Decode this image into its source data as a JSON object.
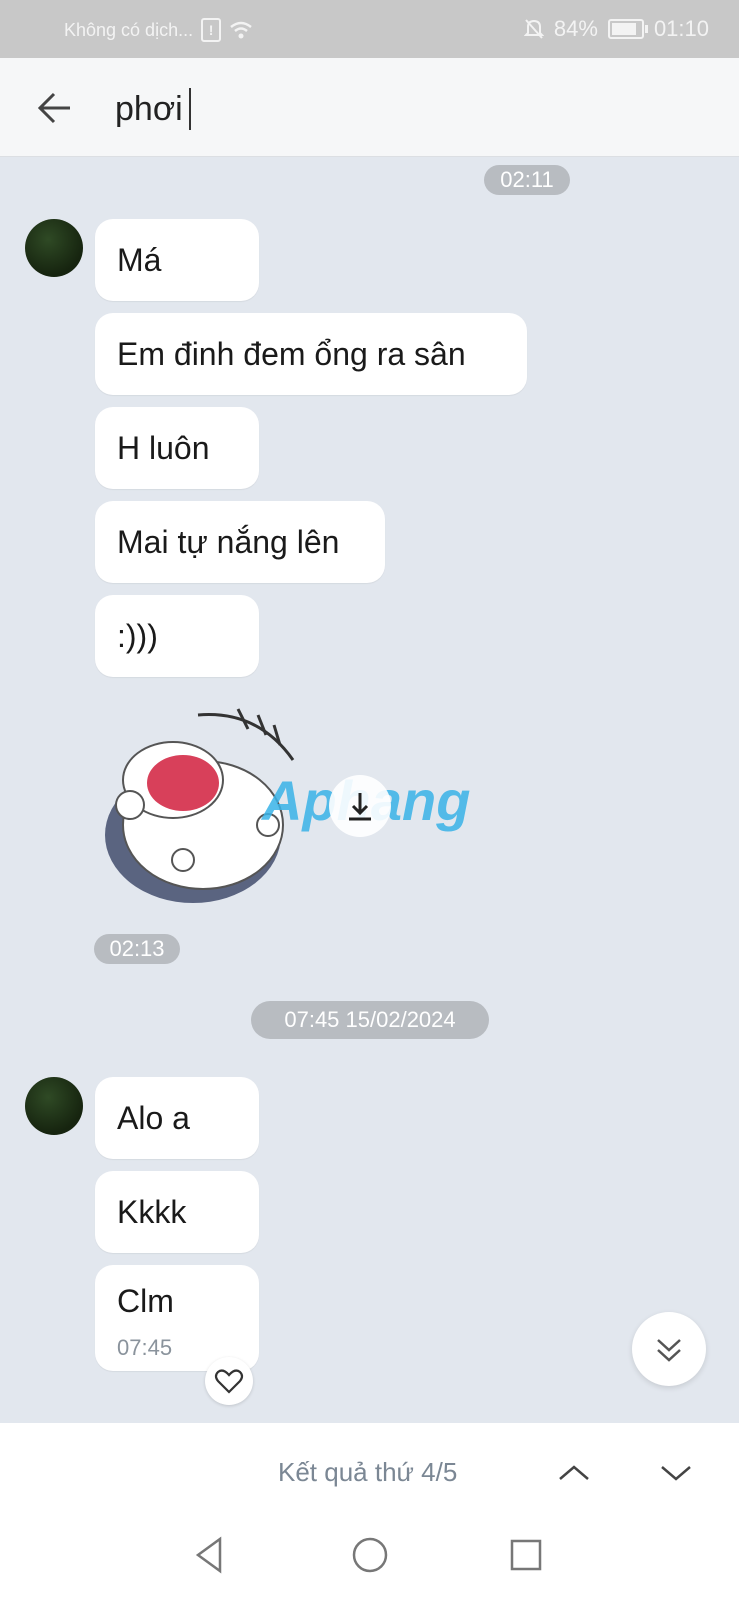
{
  "status_bar": {
    "carrier": "Không có dịch...",
    "battery": "84%",
    "time": "01:10",
    "icons": [
      "sim-alert-icon",
      "wifi-icon",
      "bell-off-icon",
      "battery-icon"
    ]
  },
  "header": {
    "back_icon": "arrow-left-icon",
    "search_query": "phơi"
  },
  "messages": {
    "chip_time_1": "02:11",
    "group1": [
      "Má",
      "Em đinh đem ổng ra sân",
      "H luôn",
      "Mai tự nắng lên",
      ":)))"
    ],
    "sticker_time": "02:13",
    "watermark": "Aphang",
    "date_chip": "07:45 15/02/2024",
    "group2": [
      "Alo a",
      "Kkkk",
      "Clm"
    ],
    "last_time": "07:45"
  },
  "search_results": {
    "label": "Kết quả thứ 4/5"
  },
  "colors": {
    "background": "#e2e7ee",
    "bubble": "#ffffff",
    "chip": "#b8bcc1",
    "status_bar": "#c8c8c8"
  }
}
